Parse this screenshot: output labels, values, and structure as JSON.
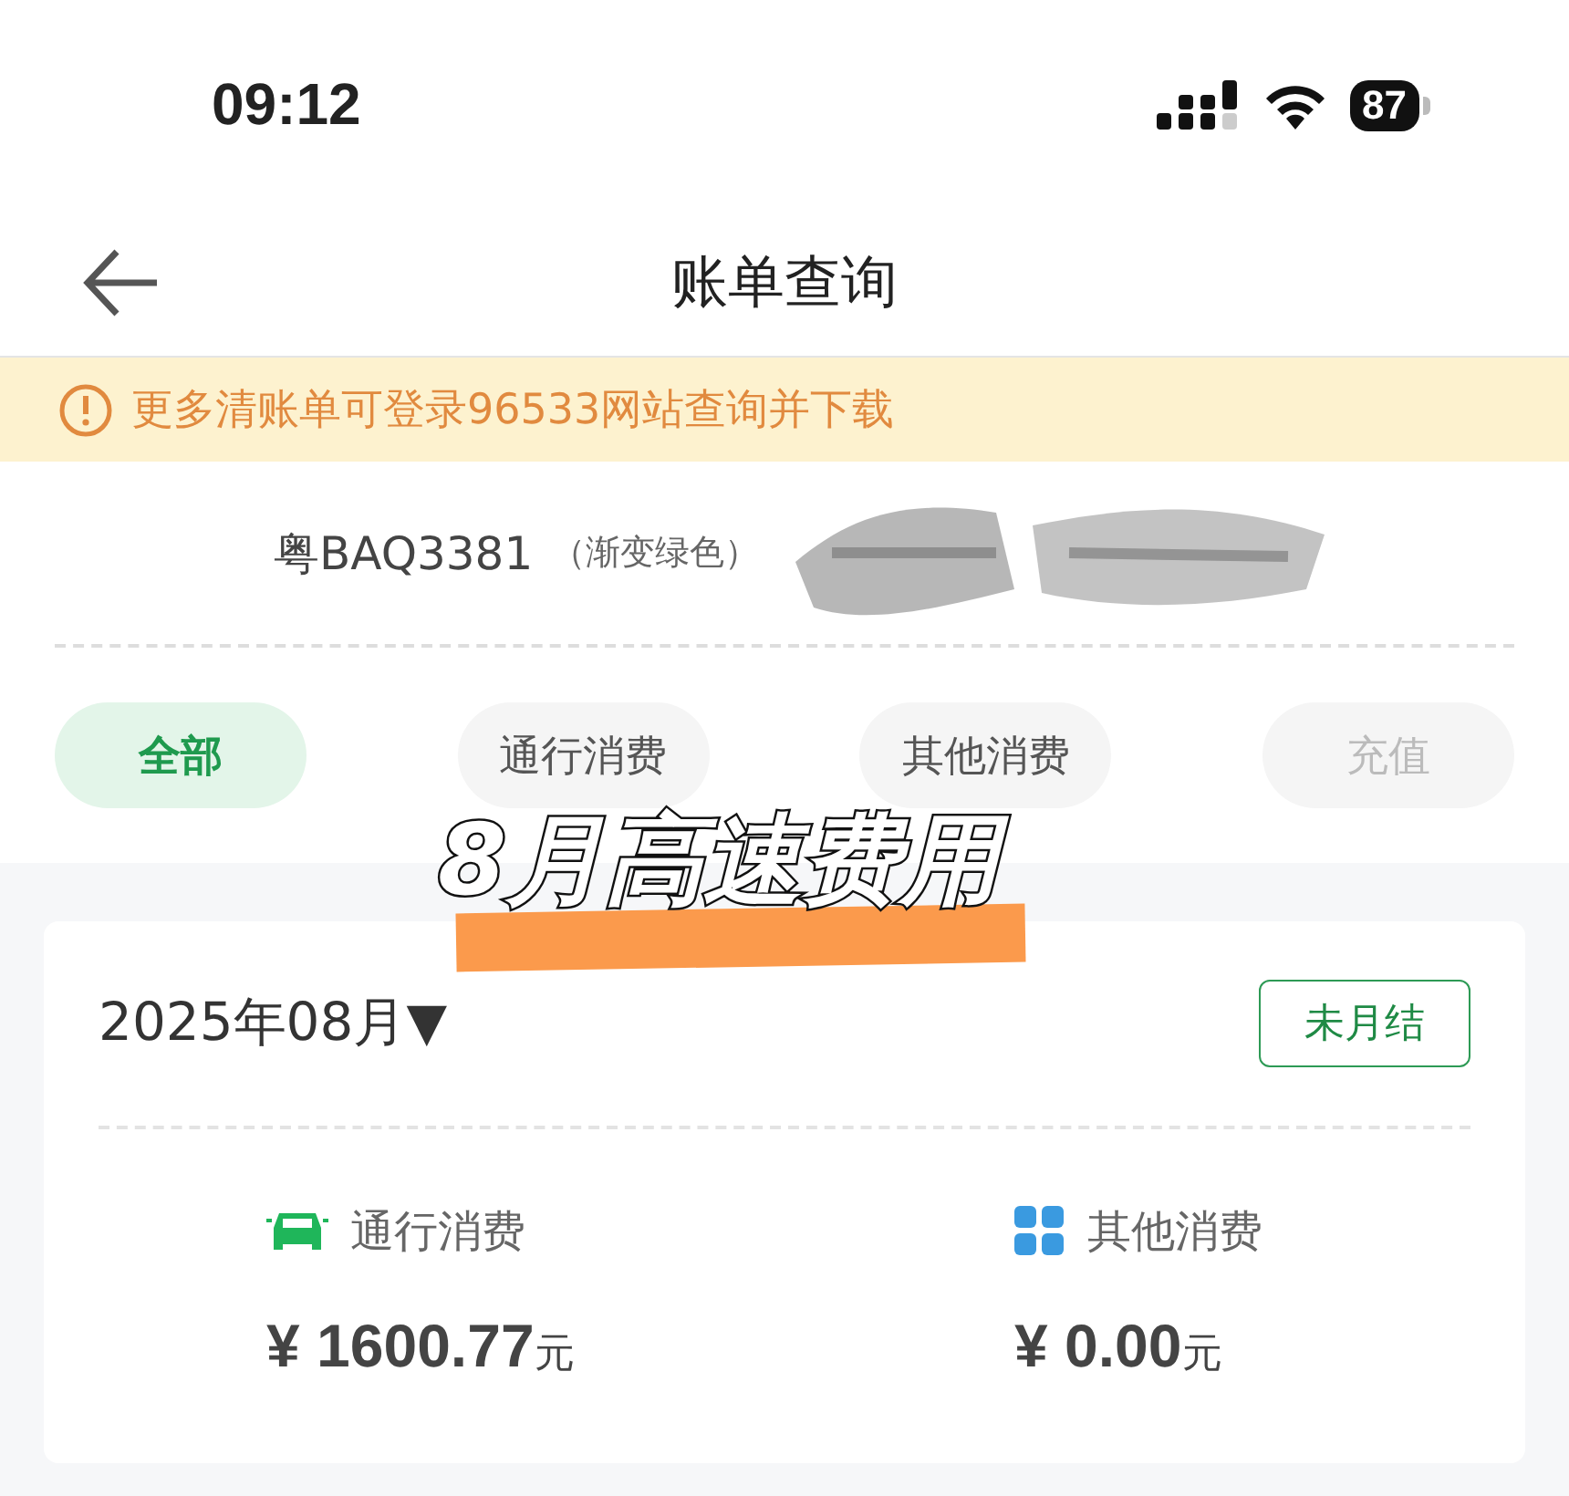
{
  "status_bar": {
    "time": "09:12",
    "battery": "87"
  },
  "nav": {
    "title": "账单查询"
  },
  "notice": {
    "text": "更多清账单可登录96533网站查询并下载"
  },
  "vehicle": {
    "plate": "粤BAQ3381",
    "plate_color": "（渐变绿色）"
  },
  "tabs": [
    {
      "label": "全部",
      "selected": true,
      "disabled": false
    },
    {
      "label": "通行消费",
      "selected": false,
      "disabled": false
    },
    {
      "label": "其他消费",
      "selected": false,
      "disabled": false
    },
    {
      "label": "充值",
      "selected": false,
      "disabled": true
    }
  ],
  "caption": {
    "text": "8月高速费用"
  },
  "bill": {
    "month": "2025年08月▼",
    "status": "未月结",
    "items": [
      {
        "kind": "toll",
        "label": "通行消费",
        "amount": "¥ 1600.77",
        "unit": "元"
      },
      {
        "kind": "other",
        "label": "其他消费",
        "amount": "¥ 0.00",
        "unit": "元"
      }
    ]
  }
}
